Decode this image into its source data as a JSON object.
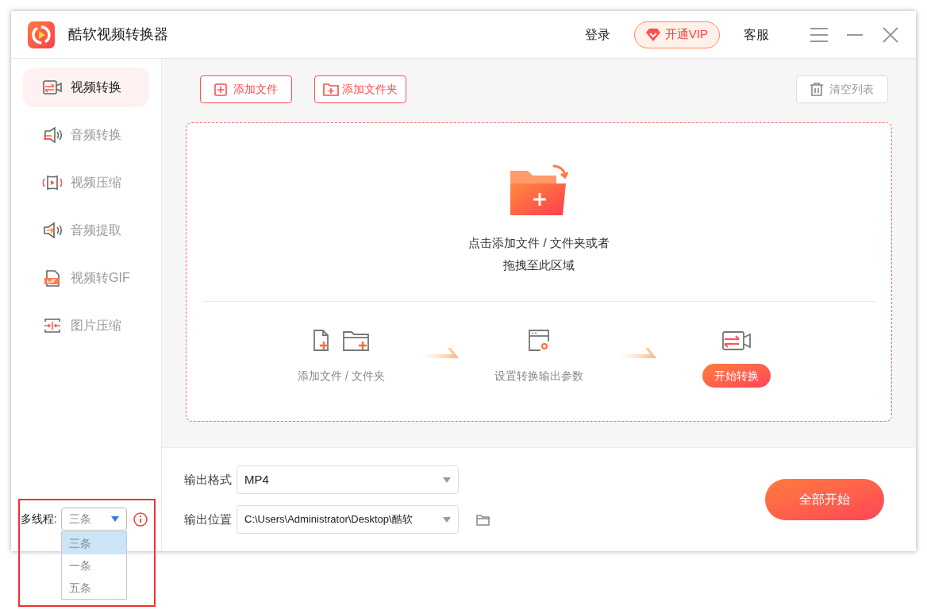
{
  "app": {
    "title": "酷软视频转换器"
  },
  "header": {
    "login": "登录",
    "vip": "开通VIP",
    "service": "客服"
  },
  "sidebar": {
    "items": [
      {
        "label": "视频转换",
        "selected": true,
        "kind": "video"
      },
      {
        "label": "音频转换",
        "selected": false,
        "kind": "audio"
      },
      {
        "label": "视频压缩",
        "selected": false,
        "kind": "compress"
      },
      {
        "label": "音频提取",
        "selected": false,
        "kind": "extract"
      },
      {
        "label": "视频转GIF",
        "selected": false,
        "kind": "gif"
      },
      {
        "label": "图片压缩",
        "selected": false,
        "kind": "image"
      }
    ],
    "threads": {
      "label": "多线程:",
      "value": "三条",
      "expanded": true,
      "options": [
        {
          "label": "三条",
          "selected": true
        },
        {
          "label": "一条",
          "selected": false
        },
        {
          "label": "五条",
          "selected": false
        }
      ]
    }
  },
  "toolbar": {
    "add_file": "添加文件",
    "add_folder": "添加文件夹",
    "clear": "清空列表"
  },
  "dropzone": {
    "hint_lines": [
      "点击添加文件 / 文件夹或者",
      "拖拽至此区域"
    ],
    "steps": [
      {
        "kind": "add",
        "label": "添加文件 / 文件夹"
      },
      {
        "kind": "settings",
        "label": "设置转换输出参数"
      },
      {
        "kind": "start",
        "label": "开始转换"
      }
    ]
  },
  "output": {
    "format_label": "输出格式",
    "format": "MP4",
    "location_label": "输出位置",
    "location": "C:\\Users\\Administrator\\Desktop\\酷软"
  },
  "start_all": "全部开始"
}
